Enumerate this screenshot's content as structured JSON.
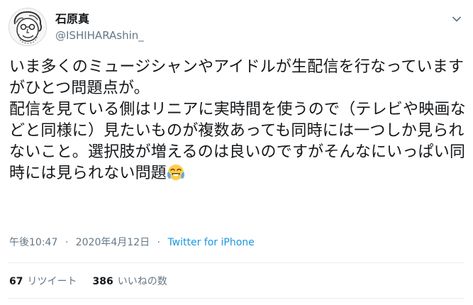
{
  "tweet": {
    "display_name": "石原真",
    "username": "@ISHIHARAshin_",
    "text_before_emoji": "いま多くのミュージシャンやアイドルが生配信を行なっていますがひとつ問題点が。\n配信を見ている側はリニアに実時間を使うので（テレビや映画などと同様に）見たいものが複数あっても同時には一つしか見られないこと。選択肢が増えるのは良いのですがそんなにいっぱい同時には見られない問題",
    "emoji_icon": "face-with-tears-of-joy-icon",
    "time": "午後10:47",
    "separator": "·",
    "date": "2020年4月12日",
    "source": "Twitter for iPhone",
    "retweet_count": "67",
    "retweet_label": "リツイート",
    "like_count": "386",
    "like_label": "いいねの数"
  },
  "colors": {
    "text": "#14171a",
    "secondary": "#657786",
    "link": "#1b95e0",
    "divider": "#e6ecf0"
  }
}
